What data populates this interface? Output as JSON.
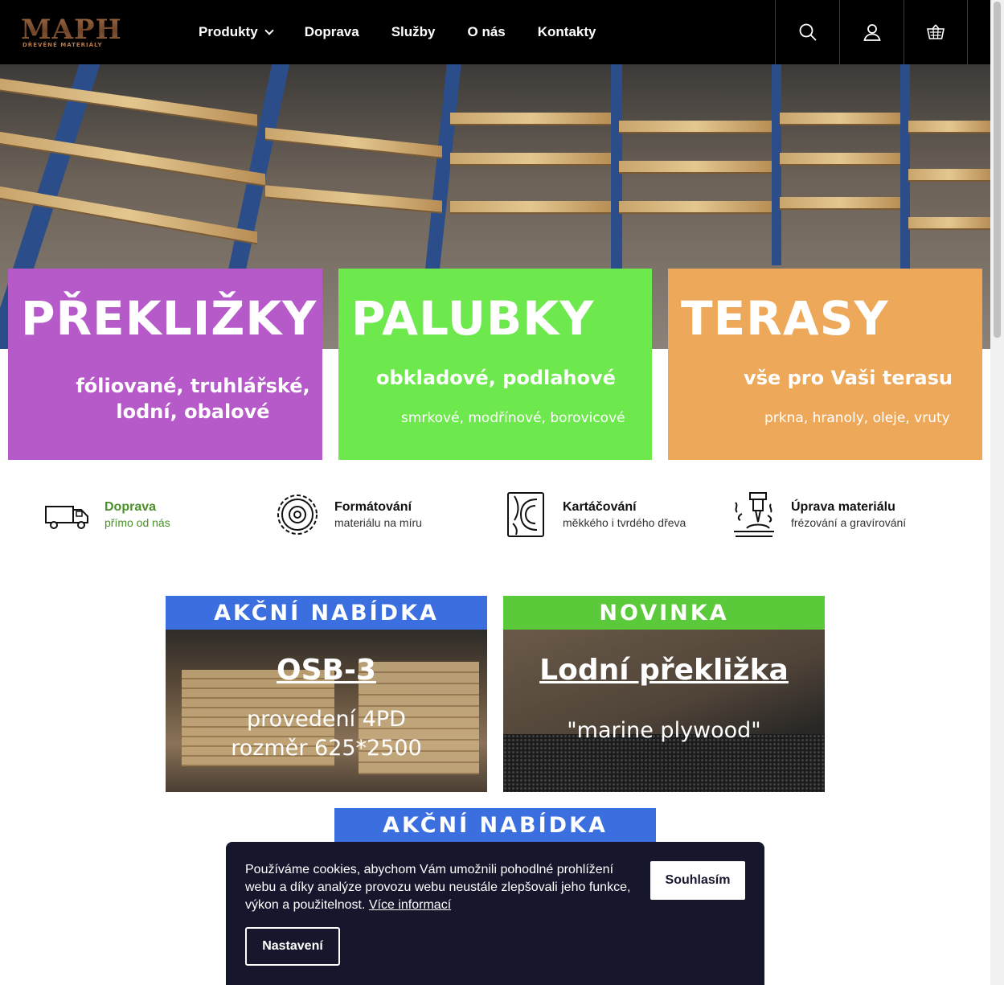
{
  "header": {
    "logo_text": "MAPH",
    "logo_tagline": "DŘEVĚNÉ MATERIÁLY",
    "nav": [
      {
        "label": "Produkty",
        "has_dropdown": true
      },
      {
        "label": "Doprava"
      },
      {
        "label": "Služby"
      },
      {
        "label": "O nás"
      },
      {
        "label": "Kontakty"
      }
    ],
    "icons": [
      "search-icon",
      "user-icon",
      "basket-icon"
    ]
  },
  "tiles": [
    {
      "title": "PŘEKLIŽKY",
      "subtitle": "fóliované, truhlářské, lodní, obalové",
      "subtitle_line1": "fóliované, truhlářské,",
      "subtitle_line2": "lodní, obalové",
      "color": "#b659c9"
    },
    {
      "title": "PALUBKY",
      "subtitle": "obkladové, podlahové",
      "detail": "smrkové, modřínové, borovicové",
      "color": "#6ee94d"
    },
    {
      "title": "TERASY",
      "subtitle": "vše pro Vaši terasu",
      "detail": "prkna, hranoly, oleje, vruty",
      "color": "#eda85a"
    }
  ],
  "features": [
    {
      "title": "Doprava",
      "subtitle": "přímo od nás",
      "icon": "truck-icon",
      "accent": "#4a8f2a"
    },
    {
      "title": "Formátování",
      "subtitle": "materiálu na míru",
      "icon": "saw-blade-icon"
    },
    {
      "title": "Kartáčování",
      "subtitle": "měkkého i tvrdého dřeva",
      "icon": "wood-grain-icon"
    },
    {
      "title": "Úprava materiálu",
      "subtitle": "frézování a gravírování",
      "icon": "cnc-mill-icon"
    }
  ],
  "promos": [
    {
      "badge": "AKČNÍ NABÍDKA",
      "title": "OSB-3",
      "line1": "provedení 4PD",
      "line2": "rozměr 625*2500",
      "badge_color": "#3b6fe0"
    },
    {
      "badge": "NOVINKA",
      "title": "Lodní překližka",
      "line1": "\"marine plywood\"",
      "badge_color": "#5ac93a"
    },
    {
      "badge": "AKČNÍ NABÍDKA",
      "badge_color": "#3b6fe0"
    }
  ],
  "cookie": {
    "text": "Používáme cookies, abychom Vám umožnili pohodlné prohlížení webu a díky analýze provozu webu neustále zlepšovali jeho funkce, výkon a použitelnost.",
    "link": "Více informací",
    "agree_label": "Souhlasím",
    "settings_label": "Nastavení"
  }
}
